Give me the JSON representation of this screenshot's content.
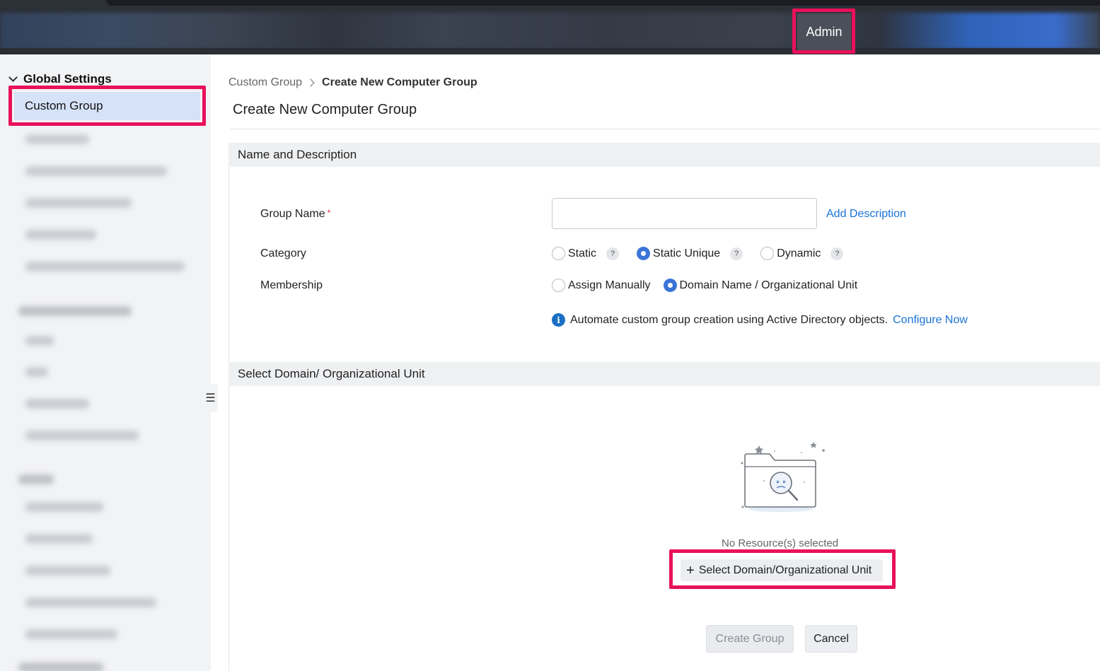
{
  "topbar": {
    "admin_label": "Admin"
  },
  "sidebar": {
    "section_title": "Global Settings",
    "active_item": "Custom Group",
    "toggle_icon": "☰"
  },
  "breadcrumb": {
    "parent": "Custom Group",
    "current": "Create New Computer Group"
  },
  "page": {
    "title": "Create New Computer Group"
  },
  "name_section": {
    "title": "Name and Description",
    "group_name_label": "Group Name",
    "required_mark": "*",
    "group_name_value": "",
    "add_description": "Add Description",
    "category_label": "Category",
    "category_options": [
      {
        "label": "Static",
        "selected": false
      },
      {
        "label": "Static Unique",
        "selected": true
      },
      {
        "label": "Dynamic",
        "selected": false
      }
    ],
    "help_glyph": "?",
    "membership_label": "Membership",
    "membership_options": [
      {
        "label": "Assign Manually",
        "selected": false
      },
      {
        "label": "Domain Name / Organizational Unit",
        "selected": true
      }
    ],
    "info_glyph": "i",
    "info_text": "Automate custom group creation using Active Directory objects.",
    "configure_now": "Configure Now"
  },
  "domain_section": {
    "title": "Select Domain/ Organizational Unit",
    "empty_text": "No Resource(s) selected",
    "select_button": "Select Domain/Organizational Unit",
    "plus_glyph": "+"
  },
  "actions": {
    "create": "Create Group",
    "cancel": "Cancel"
  },
  "colors": {
    "highlight": "#e8115a",
    "accent": "#3b74d8",
    "link": "#1a73d6"
  }
}
